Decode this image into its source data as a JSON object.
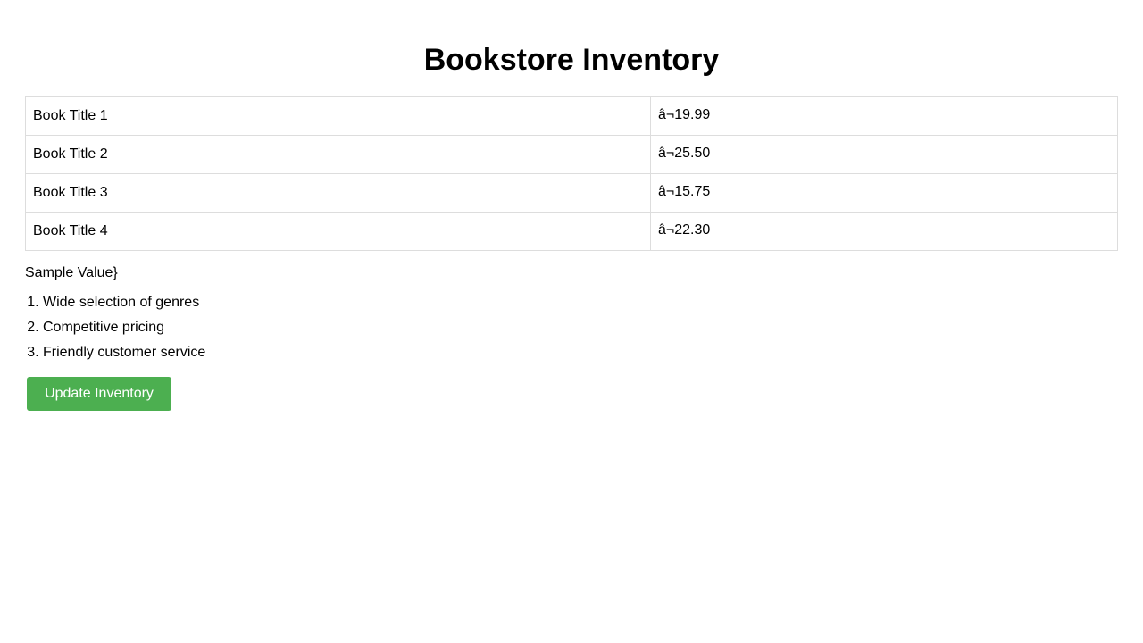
{
  "page": {
    "title": "Bookstore Inventory"
  },
  "inventory": {
    "rows": [
      {
        "title": "Book Title 1",
        "price": "â¬19.99"
      },
      {
        "title": "Book Title 2",
        "price": "â¬25.50"
      },
      {
        "title": "Book Title 3",
        "price": "â¬15.75"
      },
      {
        "title": "Book Title 4",
        "price": "â¬22.30"
      }
    ]
  },
  "sample_text": "Sample Value}",
  "features": [
    "Wide selection of genres",
    "Competitive pricing",
    "Friendly customer service"
  ],
  "actions": {
    "update_label": "Update Inventory",
    "button_color": "#4caf50"
  }
}
